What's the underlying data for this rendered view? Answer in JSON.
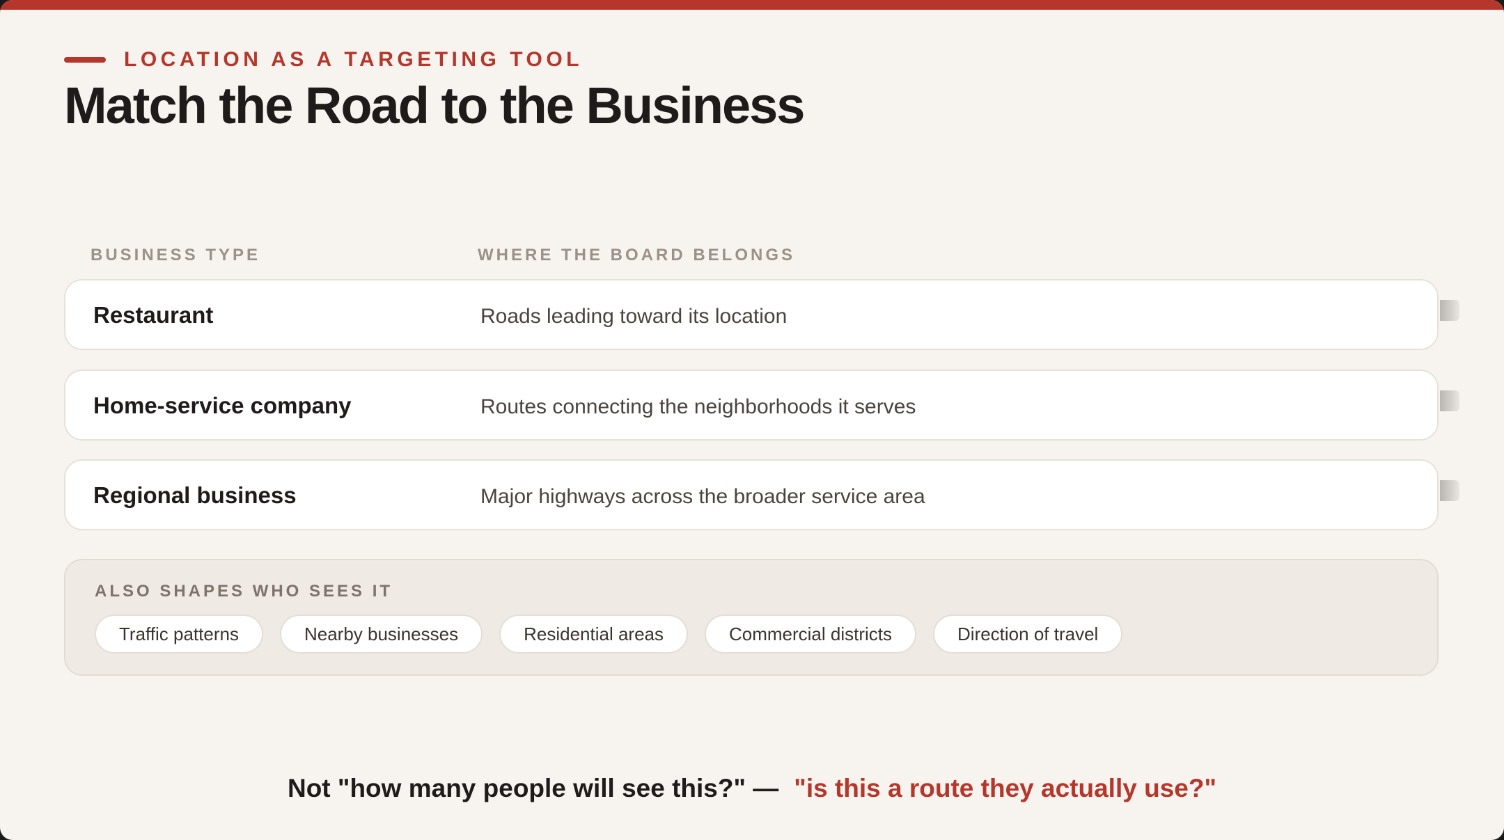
{
  "slide": {
    "eyebrow": "LOCATION AS A TARGETING TOOL",
    "title": "Match the Road to the Business"
  },
  "table": {
    "headers": {
      "business_type": "BUSINESS TYPE",
      "placement": "WHERE THE BOARD BELONGS"
    },
    "rows": [
      {
        "type": "Restaurant",
        "placement": "Roads leading toward its location"
      },
      {
        "type": "Home-service company",
        "placement": "Routes connecting the neighborhoods it serves"
      },
      {
        "type": "Regional business",
        "placement": "Major highways across the broader service area"
      }
    ]
  },
  "factors": {
    "title": "ALSO SHAPES WHO SEES IT",
    "chips": [
      "Traffic patterns",
      "Nearby businesses",
      "Residential areas",
      "Commercial districts",
      "Direction of travel"
    ]
  },
  "footer": {
    "question_plain": "Not \"how many people will see this?\" —",
    "question_accent": "\"is this a route they actually use?\""
  },
  "colors": {
    "accent": "#b5372b",
    "background": "#f7f4ef"
  }
}
